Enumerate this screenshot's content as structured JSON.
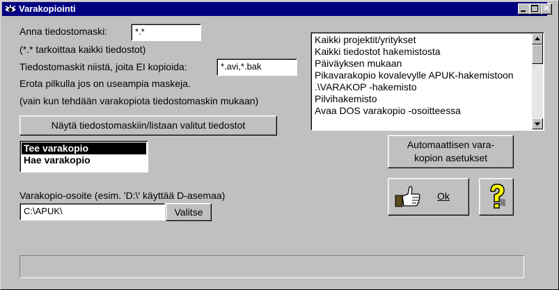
{
  "window": {
    "title": "Varakopiointi",
    "title_icon": "eye-icon",
    "controls": [
      "minimize-icon",
      "maximize-icon",
      "close-icon"
    ]
  },
  "mask": {
    "label": "Anna tiedostomaski:",
    "value": "*.*",
    "hint": "(*.* tarkoittaa kaikki tiedostot)"
  },
  "exclude": {
    "label": "Tiedostomaskit niistä, joita EI kopioida:",
    "value": "*.avi,*.bak",
    "hint1": "Erota pilkulla jos on useampia maskeja.",
    "hint2": "(vain kun tehdään varakopiota tiedostomaskin mukaan)"
  },
  "show_files_button": "Näytä tiedostomaskiin/listaan valitut tiedostot",
  "mode_list": {
    "items": [
      {
        "label": "Tee varakopio",
        "selected": true
      },
      {
        "label": "Hae varakopio",
        "selected": false
      }
    ]
  },
  "source_list": {
    "items": [
      "Kaikki projektit/yritykset",
      "Kaikki tiedostot hakemistosta",
      "Päiväyksen mukaan",
      "Pikavarakopio kovalevylle APUK-hakemistoon",
      ".\\VARAKOP -hakemisto",
      "Pilvihakemisto",
      "Avaa DOS varakopio -osoitteessa"
    ]
  },
  "auto_settings_button": {
    "line1": "Automaattisen vara-",
    "line2": "kopion asetukset"
  },
  "ok_button": {
    "label": "Ok",
    "icon": "thumbs-up-icon"
  },
  "help_button": {
    "icon": "help-question-icon"
  },
  "destination": {
    "label": "Varakopio-osoite (esim. 'D:\\' käyttää D-asemaa)",
    "value": "C:\\APUK\\",
    "browse_button": "Valitse"
  },
  "status": {
    "text": ""
  }
}
